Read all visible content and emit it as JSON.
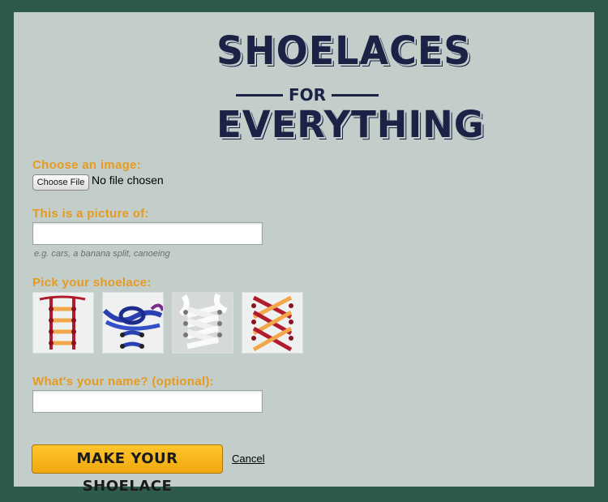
{
  "logo": {
    "line1": "SHOELACES",
    "line2": "FOR",
    "line3": "EVERYTHING"
  },
  "form": {
    "image_label": "Choose an image:",
    "file_button": "Choose File",
    "file_status": "No file chosen",
    "picture_label": "This is a picture of:",
    "picture_value": "",
    "picture_hint": "e.g. cars, a banana split, canoeing",
    "shoelace_label": "Pick your shoelace:",
    "shoelace_options": [
      "ladder-lace",
      "knotted-lace",
      "white-lace",
      "criss-cross-lace"
    ],
    "name_label": "What's your name? (optional):",
    "name_value": "",
    "submit_label": "MAKE YOUR SHOELACE",
    "cancel_label": "Cancel"
  },
  "colors": {
    "background": "#2d5a4c",
    "panel": "#c3cecb",
    "label": "#e69a1e",
    "logo": "#1c2246",
    "button": "#f7b71c"
  }
}
